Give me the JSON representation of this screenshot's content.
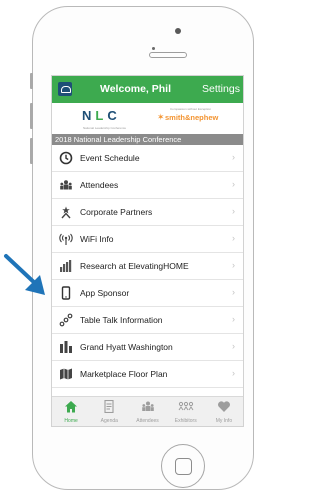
{
  "header": {
    "title": "Welcome, Phil",
    "settings_label": "Settings"
  },
  "logos": {
    "nlc": [
      "N",
      "L",
      "C"
    ],
    "nlc_sub": "National Leadership Conference",
    "sponsor_top": "Compassion without Exception",
    "sponsor": "smith&nephew"
  },
  "banner": "2018 National Leadership Conference",
  "menu": [
    {
      "label": "Event Schedule",
      "icon": "clock-icon"
    },
    {
      "label": "Attendees",
      "icon": "people-icon"
    },
    {
      "label": "Corporate Partners",
      "icon": "star-person-icon"
    },
    {
      "label": "WiFi Info",
      "icon": "wifi-icon"
    },
    {
      "label": "Research at ElevatingHOME",
      "icon": "bar-chart-icon"
    },
    {
      "label": "App Sponsor",
      "icon": "phone-icon"
    },
    {
      "label": "Table Talk Information",
      "icon": "chain-icon"
    },
    {
      "label": "Grand Hyatt Washington",
      "icon": "building-icon"
    },
    {
      "label": "Marketplace Floor Plan",
      "icon": "map-icon"
    }
  ],
  "tabs": [
    {
      "label": "Home",
      "icon": "home-icon",
      "active": true
    },
    {
      "label": "Agenda",
      "icon": "document-icon",
      "active": false
    },
    {
      "label": "Attendees",
      "icon": "people-icon",
      "active": false
    },
    {
      "label": "Exhibitors",
      "icon": "group-icon",
      "active": false
    },
    {
      "label": "My Info",
      "icon": "heart-icon",
      "active": false
    }
  ],
  "colors": {
    "header": "#3daa4f",
    "navy": "#1e4f76",
    "arrow": "#1f74b8",
    "sponsor": "#f39431",
    "banner": "#8b8b8b"
  }
}
